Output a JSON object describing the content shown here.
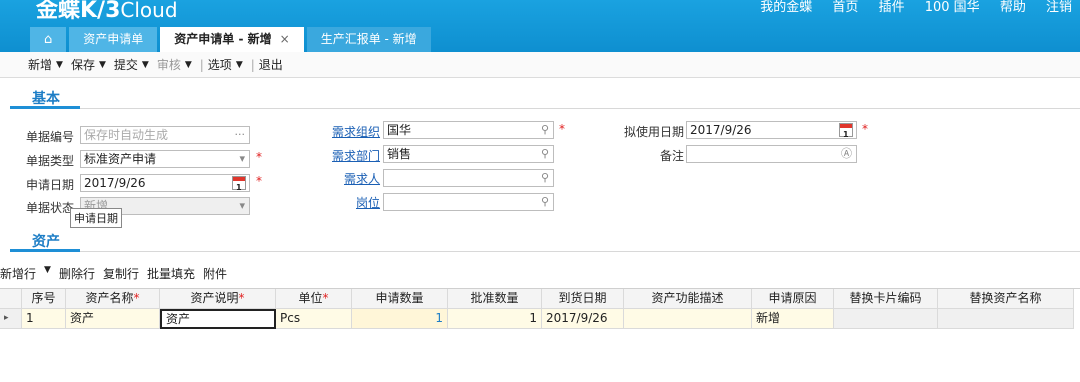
{
  "header": {
    "logo_main": "金蝶K/3",
    "logo_sub": "Cloud",
    "links": [
      "我的金蝶",
      "首页",
      "插件",
      "100 国华",
      "帮助",
      "注销"
    ]
  },
  "tabs": [
    {
      "label": "资产申请单"
    },
    {
      "label": "资产申请单 - 新增",
      "close": "×"
    },
    {
      "label": "生产汇报单 - 新增"
    }
  ],
  "toolbar": {
    "new": "新增",
    "save": "保存",
    "submit": "提交",
    "audit": "审核",
    "options": "选项",
    "exit": "退出",
    "arrow": "▼",
    "sep": "|"
  },
  "sections": {
    "basic": "基本",
    "asset": "资产"
  },
  "form": {
    "bill_no_label": "单据编号",
    "bill_no_placeholder": "保存时自动生成",
    "bill_no_btn": "···",
    "bill_type_label": "单据类型",
    "bill_type_value": "标准资产申请",
    "apply_date_label": "申请日期",
    "apply_date_value": "2017/9/26",
    "bill_status_label": "单据状态",
    "bill_status_value": "新增",
    "tooltip": "申请日期",
    "demand_org_label": "需求组织",
    "demand_org_value": "国华",
    "demand_dept_label": "需求部门",
    "demand_dept_value": "销售",
    "demander_label": "需求人",
    "demander_value": "",
    "post_label": "岗位",
    "post_value": "",
    "plan_date_label": "拟使用日期",
    "plan_date_value": "2017/9/26",
    "remark_label": "备注",
    "remark_value": "",
    "cal_day": "1",
    "req": "*",
    "search_icon": "⚲",
    "dropdown_icon": "▾",
    "remark_icon": "Ⓐ"
  },
  "grid_toolbar": {
    "add_row": "新增行",
    "arrow": "▼",
    "del_row": "删除行",
    "copy_row": "复制行",
    "batch_fill": "批量填充",
    "attach": "附件"
  },
  "grid": {
    "columns": [
      "序号",
      "资产名称",
      "资产说明",
      "单位",
      "申请数量",
      "批准数量",
      "到货日期",
      "资产功能描述",
      "申请原因",
      "替换卡片编码",
      "替换资产名称"
    ],
    "required_cols": [
      1,
      2,
      3
    ],
    "rows": [
      {
        "no": "1",
        "name": "资产",
        "desc": "资产",
        "unit": "Pcs",
        "apply_qty": "1",
        "approve_qty": "1",
        "arrive_date": "2017/9/26",
        "func_desc": "",
        "reason": "新增",
        "replace_code": "",
        "replace_name": ""
      }
    ],
    "row_marker": "▸",
    "req_star": "*"
  }
}
